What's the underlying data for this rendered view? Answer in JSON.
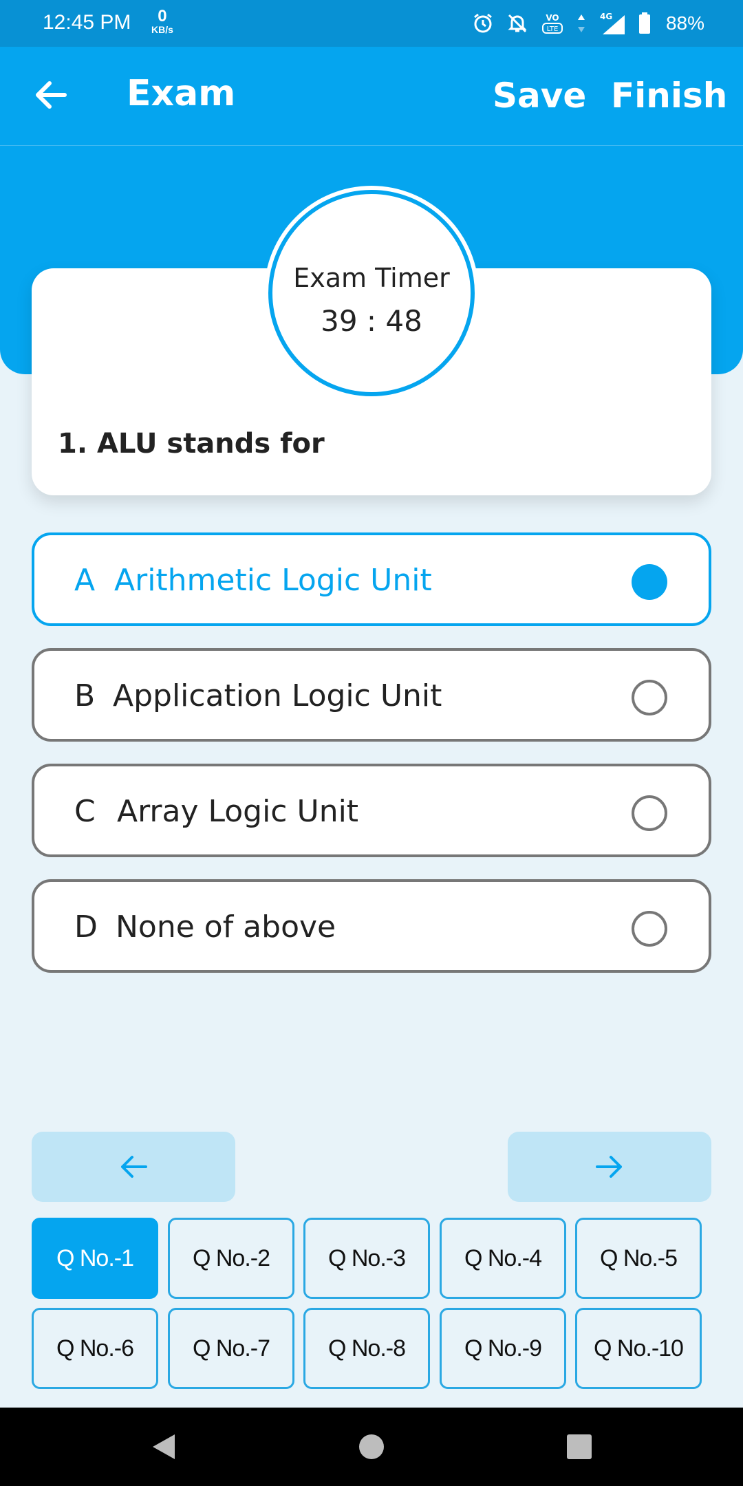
{
  "status_bar": {
    "time": "12:45 PM",
    "speed_value": "0",
    "speed_unit": "KB/s",
    "network": "4G",
    "volte": "VO LTE",
    "battery": "88%"
  },
  "app_bar": {
    "title": "Exam",
    "save_label": "Save",
    "finish_label": "Finish"
  },
  "timer": {
    "label": "Exam Timer",
    "value": "39 : 48"
  },
  "question": {
    "text": "1. ALU stands for"
  },
  "options": [
    {
      "letter": "A",
      "text": "Arithmetic Logic Unit",
      "selected": true
    },
    {
      "letter": "B",
      "text": "Application Logic Unit",
      "selected": false
    },
    {
      "letter": "C",
      "text": "Array Logic Unit",
      "selected": false
    },
    {
      "letter": "D",
      "text": "None of above",
      "selected": false
    }
  ],
  "navigation": {
    "prev_icon": "arrow-left-icon",
    "next_icon": "arrow-right-icon"
  },
  "question_buttons": [
    {
      "label": "Q No.-1",
      "active": true
    },
    {
      "label": "Q No.-2",
      "active": false
    },
    {
      "label": "Q No.-3",
      "active": false
    },
    {
      "label": "Q No.-4",
      "active": false
    },
    {
      "label": "Q No.-5",
      "active": false
    },
    {
      "label": "Q No.-6",
      "active": false
    },
    {
      "label": "Q No.-7",
      "active": false
    },
    {
      "label": "Q No.-8",
      "active": false
    },
    {
      "label": "Q No.-9",
      "active": false
    },
    {
      "label": "Q No.-10",
      "active": false
    }
  ],
  "colors": {
    "primary": "#05a5ef",
    "status_bar": "#0891d4",
    "background": "#e8f3f9",
    "nav_button": "#bfe5f6"
  }
}
